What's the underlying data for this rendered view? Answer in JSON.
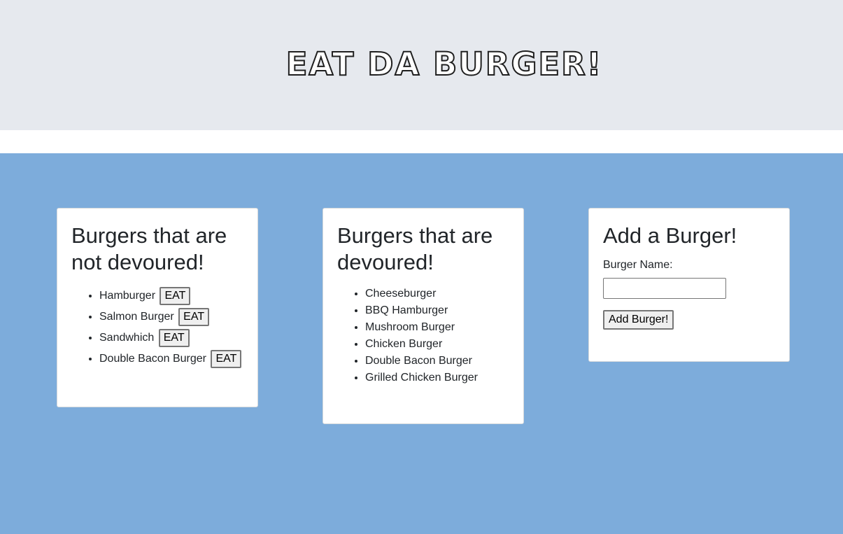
{
  "header": {
    "title": "EAT DA BURGER!"
  },
  "uneaten": {
    "heading": "Burgers that are not devoured!",
    "button_label": "EAT",
    "items": [
      {
        "name": "Hamburger"
      },
      {
        "name": "Salmon Burger"
      },
      {
        "name": "Sandwhich"
      },
      {
        "name": "Double Bacon Burger"
      }
    ]
  },
  "eaten": {
    "heading": "Burgers that are devoured!",
    "items": [
      {
        "name": "Cheeseburger"
      },
      {
        "name": "BBQ Hamburger"
      },
      {
        "name": "Mushroom Burger"
      },
      {
        "name": "Chicken Burger"
      },
      {
        "name": "Double Bacon Burger"
      },
      {
        "name": "Grilled Chicken Burger"
      }
    ]
  },
  "add_form": {
    "heading": "Add a Burger!",
    "label": "Burger Name:",
    "input_value": "",
    "submit_label": "Add Burger!"
  },
  "colors": {
    "header_bg": "#e6e9ee",
    "main_bg": "#7dacdb",
    "card_bg": "#ffffff"
  }
}
